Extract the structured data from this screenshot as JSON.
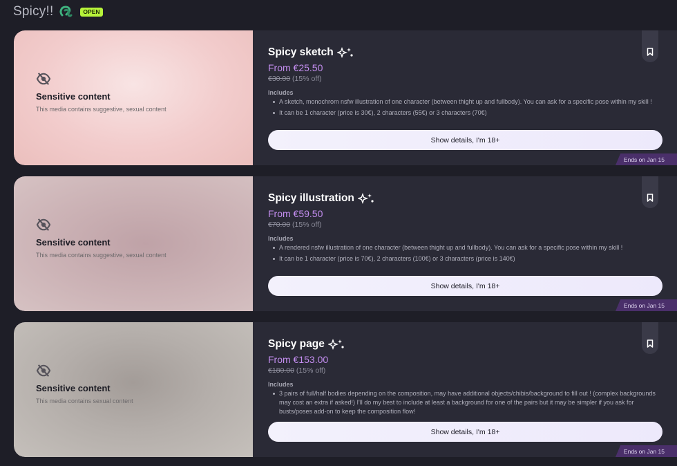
{
  "header": {
    "title": "Spicy!!",
    "logo_icon": "shop-logo-icon",
    "status": "OPEN"
  },
  "colors": {
    "accent_price": "#c48ef0",
    "badge_green": "#b7f33a",
    "card_bg": "#2a2a36"
  },
  "cards": [
    {
      "title": "Spicy sketch",
      "price_from": "From €25.50",
      "price_old": "€30.00",
      "discount": "(15% off)",
      "includes_label": "Includes",
      "includes": [
        "A sketch, monochrom nsfw illustration of one character (between thight up and fullbody). You can ask for a specific pose within my skill !",
        "It can be 1 character (price is 30€), 2 characters (55€) or 3 characters (70€)"
      ],
      "sensitive_title": "Sensitive content",
      "sensitive_desc": "This media contains suggestive, sexual content",
      "button": "Show details, I'm 18+",
      "ends": "Ends on Jan 15"
    },
    {
      "title": "Spicy illustration",
      "price_from": "From €59.50",
      "price_old": "€70.00",
      "discount": "(15% off)",
      "includes_label": "Includes",
      "includes": [
        "A rendered nsfw illustration of one character (between thight up and fullbody). You can ask for a specific pose within my skill !",
        "It can be 1 character (price is 70€), 2 characters (100€) or 3 characters (price is 140€)"
      ],
      "sensitive_title": "Sensitive content",
      "sensitive_desc": "This media contains suggestive, sexual content",
      "button": "Show details, I'm 18+",
      "ends": "Ends on Jan 15"
    },
    {
      "title": "Spicy page",
      "price_from": "From €153.00",
      "price_old": "€180.00",
      "discount": "(15% off)",
      "includes_label": "Includes",
      "includes": [
        "3 pairs of full/half bodies depending on the composition, may have additional objects/chibis/background to fill out ! (complex backgrounds may cost an extra if asked!) I'll do my best to include at least a background for one of the pairs but it may be simpler if you ask for busts/poses add-on to keep the composition flow!"
      ],
      "sensitive_title": "Sensitive content",
      "sensitive_desc": "This media contains sexual content",
      "button": "Show details, I'm 18+",
      "ends": "Ends on Jan 15"
    }
  ]
}
